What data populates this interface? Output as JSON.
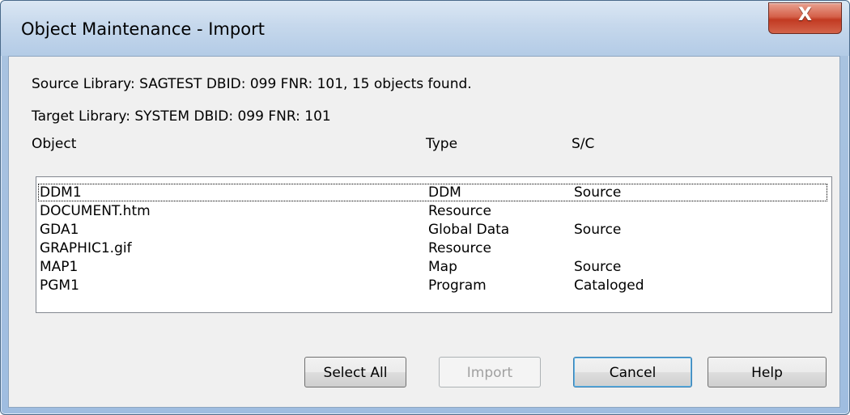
{
  "window": {
    "title": "Object Maintenance - Import",
    "close_glyph": "X"
  },
  "info": {
    "source_line": "Source Library: SAGTEST  DBID: 099  FNR: 101, 15 objects found.",
    "target_line": "Target Library: SYSTEM  DBID: 099  FNR: 101"
  },
  "columns": {
    "object": "Object",
    "type": "Type",
    "sc": "S/C"
  },
  "rows": [
    {
      "object": "DDM1",
      "type": "DDM",
      "sc": "Source"
    },
    {
      "object": "DOCUMENT.htm",
      "type": "Resource",
      "sc": ""
    },
    {
      "object": "GDA1",
      "type": "Global Data",
      "sc": "Source"
    },
    {
      "object": "GRAPHIC1.gif",
      "type": "Resource",
      "sc": ""
    },
    {
      "object": "MAP1",
      "type": "Map",
      "sc": "Source"
    },
    {
      "object": "PGM1",
      "type": "Program",
      "sc": "Cataloged"
    }
  ],
  "buttons": {
    "select_all": "Select All",
    "import": "Import",
    "cancel": "Cancel",
    "help": "Help"
  },
  "colors": {
    "close_button": "#c9452d",
    "disabled_text": "#a0a0a0",
    "default_button_border": "#3c7fb1"
  }
}
